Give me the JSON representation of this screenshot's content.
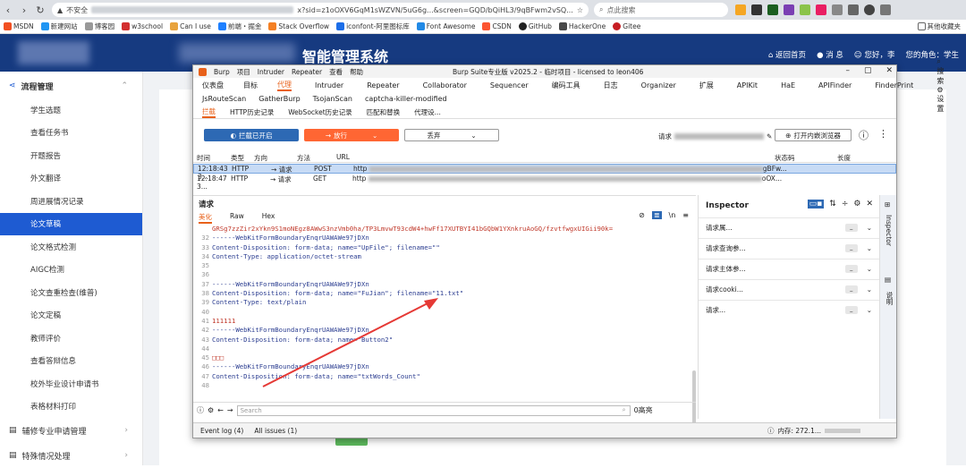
{
  "browser": {
    "url_prefix": "不安全",
    "url_fragment": "x?sid=z1oOXV6GqM1sWZVN/5uG6g...&screen=GQD/bQiHL3/9qBFwm2vSQ...",
    "search_placeholder": "点此搜索",
    "bookmarks": [
      "MSDN",
      "新建网站",
      "博客园",
      "w3school",
      "Can I use",
      "前端・掘金",
      "Stack Overflow",
      "iconfont-阿里图标库",
      "Font Awesome",
      "CSDN",
      "GitHub",
      "HackerOne",
      "Gitee"
    ],
    "other_bookmarks": "其他收藏夹"
  },
  "app": {
    "title": "智能管理系统",
    "header_links": [
      "返回首页",
      "消 息",
      "您好，李",
      "您的角色：学生"
    ]
  },
  "sidebar": {
    "group1": "流程管理",
    "items": [
      "学生选题",
      "查看任务书",
      "开题报告",
      "外文翻译",
      "周进展情况记录",
      "论文草稿",
      "论文格式检测",
      "AIGC检测",
      "论文查重检查(维普)",
      "论文定稿",
      "教师评价",
      "查看答辩信息",
      "校外毕业设计申请书",
      "表格材料打印"
    ],
    "active_index": 5,
    "group2": "辅修专业申请管理",
    "group3": "特殊情况处理"
  },
  "burp": {
    "menu": [
      "Burp",
      "项目",
      "Intruder",
      "Repeater",
      "查看",
      "帮助"
    ],
    "window_title": "Burp Suite专业版  v2025.2 - 临时项目 - licensed to leon406",
    "tabs1": [
      "仪表盘",
      "目标",
      "代理",
      "Intruder",
      "Repeater",
      "Collaborator",
      "Sequencer",
      "编码工具",
      "日志",
      "Organizer",
      "扩展",
      "APIKit",
      "HaE",
      "APIFinder",
      "FinderPrint"
    ],
    "tabs1_active": 2,
    "tabs1_right": [
      "搜索",
      "设置"
    ],
    "tabs2": [
      "JsRouteScan",
      "GatherBurp",
      "TsojanScan",
      "captcha-killer-modified"
    ],
    "tabs3": [
      "拦截",
      "HTTP历史记录",
      "WebSocket历史记录",
      "匹配和替换",
      "代理设..."
    ],
    "intercept_btn": "拦截已开启",
    "forward_btn": "放行",
    "drop_btn": "丢弃",
    "request_to": "请求",
    "open_browser": "打开内嵌浏览器",
    "table_headers": [
      "时间",
      "类型",
      "方向",
      "方法",
      "URL",
      "状态码",
      "长度"
    ],
    "rows": [
      {
        "time": "12:18:43 3...",
        "type": "HTTP",
        "dir": "→ 请求",
        "method": "POST",
        "url": "http",
        "tail": "gBFw..."
      },
      {
        "time": "12:18:47 3...",
        "type": "HTTP",
        "dir": "→ 请求",
        "method": "GET",
        "url": "http",
        "tail": "oOX..."
      }
    ],
    "request_title": "请求",
    "request_tabs": [
      "美化",
      "Raw",
      "Hex"
    ],
    "code_lines": [
      {
        "n": "",
        "t": "GRSg7zzZir2xYkn9S1moNEgz8AWwS3nzVmb0ha/TP3LmvwT93cdW4+hwFf17XUTBYI41bGQbW1YXnkruAoGQ/fzvtfwgxUIGii90k=",
        "c": "red"
      },
      {
        "n": "32",
        "t": "------WebKitFormBoundaryEnqrUAWAWe97jDXn",
        "c": "blu"
      },
      {
        "n": "33",
        "t": "Content-Disposition: form-data; name=\"UpFile\"; filename=\"\"",
        "c": "blu"
      },
      {
        "n": "34",
        "t": "Content-Type: application/octet-stream",
        "c": "blu"
      },
      {
        "n": "35",
        "t": "",
        "c": "blu"
      },
      {
        "n": "36",
        "t": "",
        "c": "blu"
      },
      {
        "n": "37",
        "t": "------WebKitFormBoundaryEnqrUAWAWe97jDXn",
        "c": "blu"
      },
      {
        "n": "38",
        "t": "Content-Disposition: form-data; name=\"FuJian\"; filename=\"11.txt\"",
        "c": "blu"
      },
      {
        "n": "39",
        "t": "Content-Type: text/plain",
        "c": "blu"
      },
      {
        "n": "40",
        "t": "",
        "c": "blu"
      },
      {
        "n": "41",
        "t": "111111",
        "c": "red"
      },
      {
        "n": "42",
        "t": "------WebKitFormBoundaryEnqrUAWAWe97jDXn",
        "c": "blu"
      },
      {
        "n": "43",
        "t": "Content-Disposition: form-data; name=\"Button2\"",
        "c": "blu"
      },
      {
        "n": "44",
        "t": "",
        "c": "blu"
      },
      {
        "n": "45",
        "t": "□□□",
        "c": "red"
      },
      {
        "n": "46",
        "t": "------WebKitFormBoundaryEnqrUAWAWe97jDXn",
        "c": "blu"
      },
      {
        "n": "47",
        "t": "Content-Disposition: form-data; name=\"txtWords_Count\"",
        "c": "blu"
      },
      {
        "n": "48",
        "t": "",
        "c": "blu"
      }
    ],
    "search_placeholder": "Search",
    "highlights": "0高亮",
    "inspector_title": "Inspector",
    "inspector_rows": [
      "请求属...",
      "请求查询参...",
      "请求主体参...",
      "请求cooki...",
      "请求..."
    ],
    "side_tabs": [
      "Inspector",
      "说明"
    ],
    "status": [
      "Event log (4)",
      "All issues (1)"
    ],
    "memory": "内存: 272.1..."
  },
  "colors": {
    "header_bg": "#163a80",
    "active_item": "#1e5bd2",
    "burp_orange": "#e8611a"
  }
}
